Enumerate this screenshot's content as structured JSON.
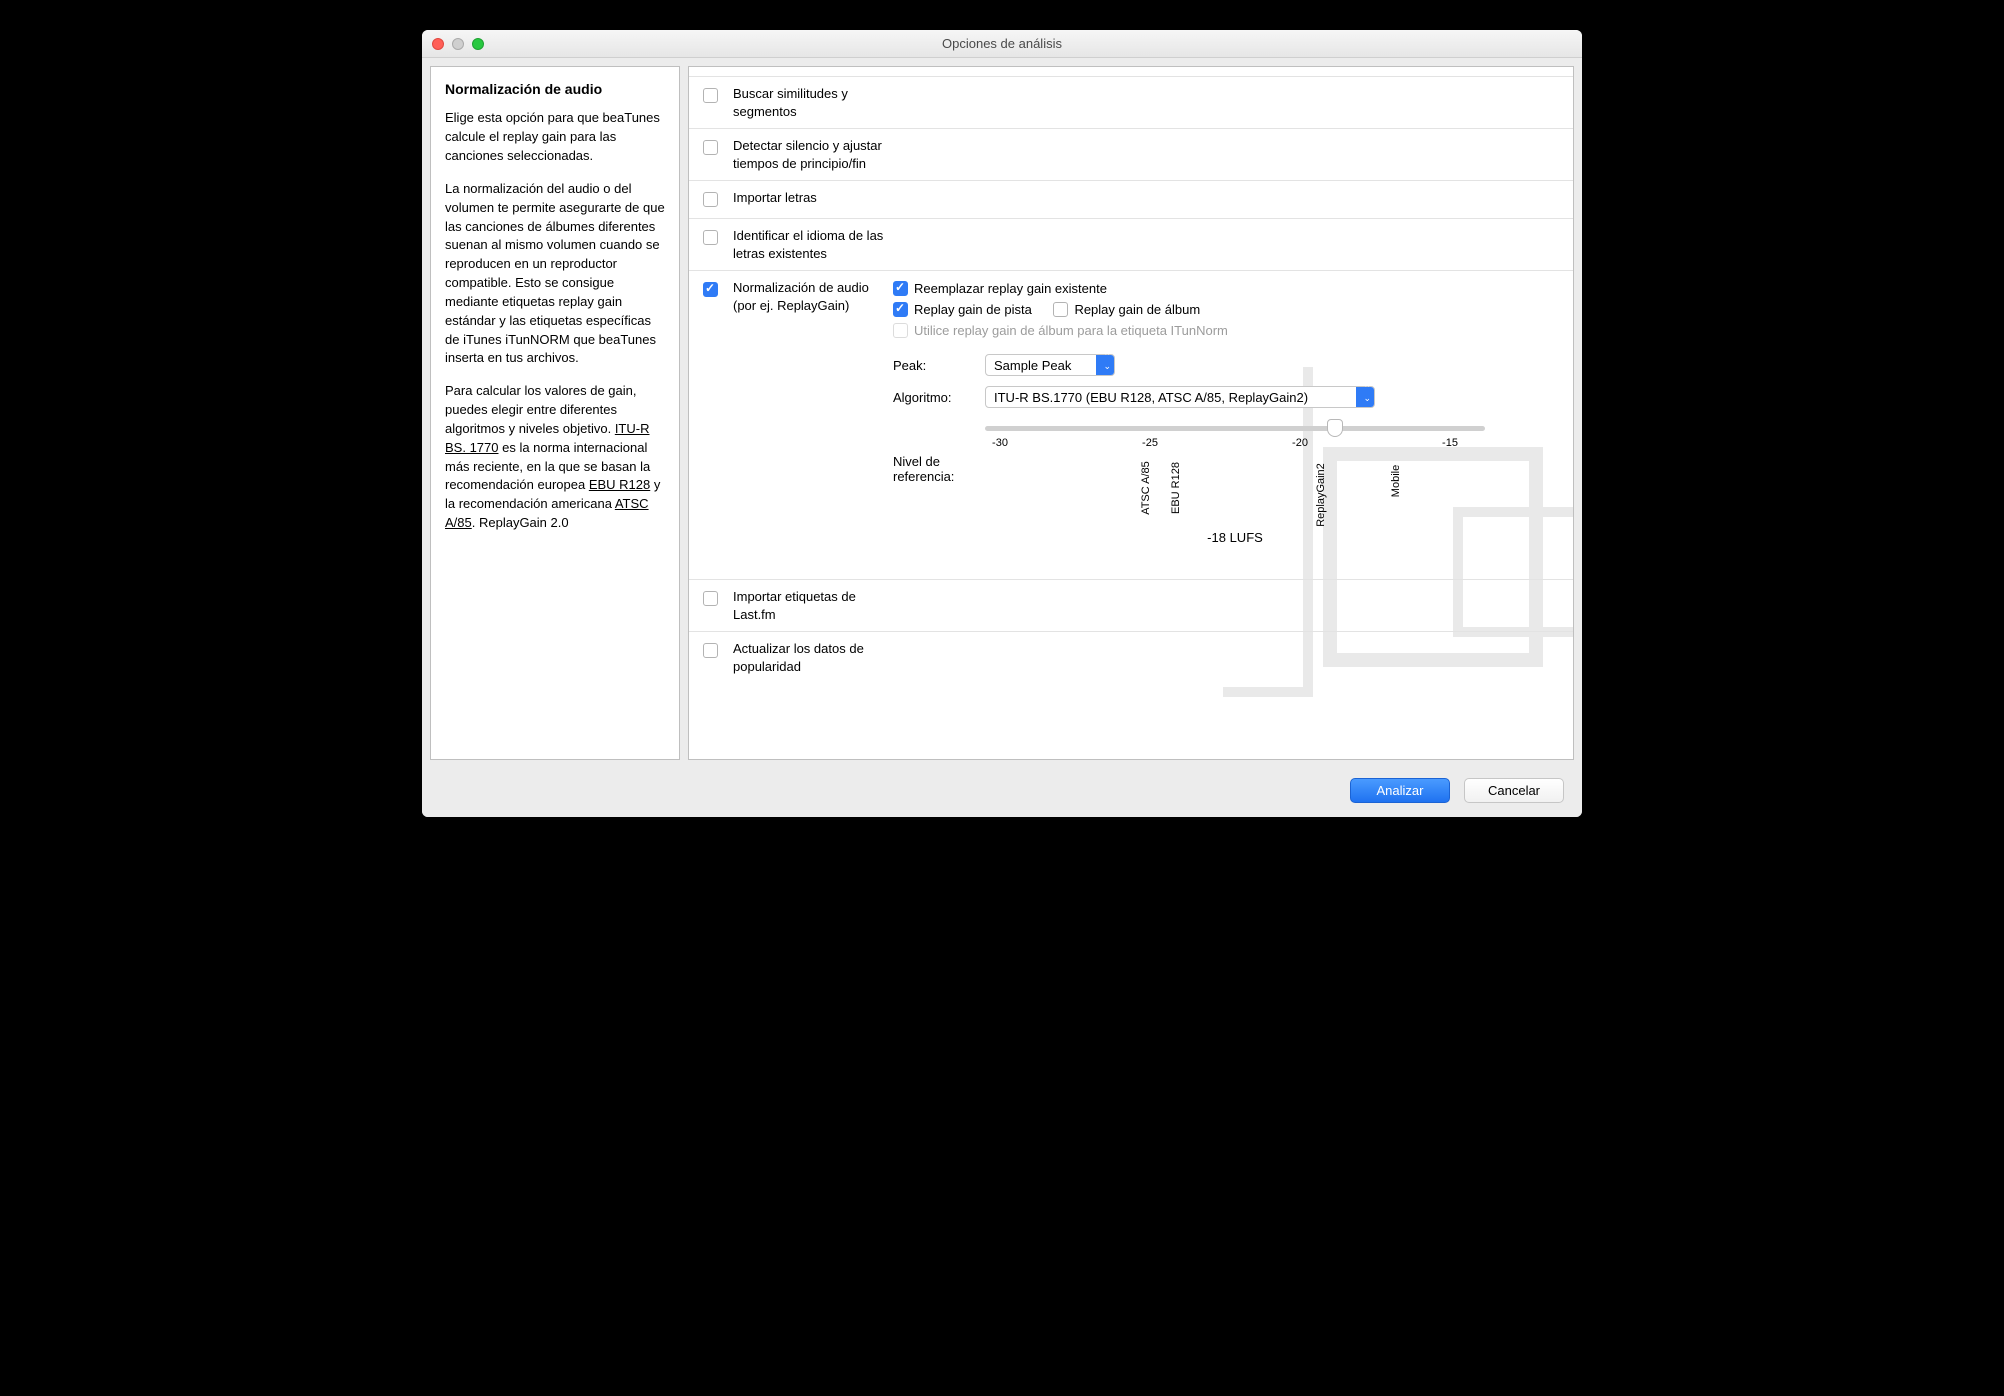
{
  "titlebar": {
    "title": "Opciones de análisis"
  },
  "sidebar": {
    "heading": "Normalización de audio",
    "p1": "Elige esta opción para que beaTunes calcule el replay gain para las canciones seleccionadas.",
    "p2": "La normalización del audio o del volumen te permite asegurarte de que las canciones de álbumes diferentes suenan al mismo volumen cuando se reproducen en un reproductor compatible. Esto se consigue mediante etiquetas replay gain estándar y las etiquetas específicas de iTunes iTunNORM que beaTunes inserta en tus archivos.",
    "p3a": "Para calcular los valores de gain, puedes elegir entre diferentes algoritmos y niveles objetivo. ",
    "link1": "ITU-R BS. 1770",
    "p3b": " es la norma internacional más reciente, en la que se basan la recomendación europea ",
    "link2": "EBU R128",
    "p3c": " y la recomendación americana ",
    "link3": "ATSC A/85",
    "p3d": ". ReplayGain 2.0"
  },
  "rows": {
    "similitudes": "Buscar similitudes y segmentos",
    "silencio": "Detectar silencio y ajustar tiempos de principio/fin",
    "letras": "Importar letras",
    "idioma": "Identificar el idioma de las letras existentes",
    "norm_title": "Normalización de audio (por ej. ReplayGain)",
    "reemplazar": "Reemplazar replay gain existente",
    "pista": "Replay gain de pista",
    "album": "Replay gain de álbum",
    "itunnorm": "Utilice replay gain de álbum para la etiqueta ITunNorm",
    "peak_label": "Peak:",
    "peak_value": "Sample Peak",
    "algo_label": "Algoritmo:",
    "algo_value": "ITU-R BS.1770 (EBU R128, ATSC A/85, ReplayGain2)",
    "nivel_label1": "Nivel de",
    "nivel_label2": "referencia:",
    "lufs": "-18 LUFS",
    "ticks_num": {
      "n30": "-30",
      "n25": "-25",
      "n20": "-20",
      "n15": "-15"
    },
    "ticks_lbl": {
      "atsc": "ATSC A/85",
      "ebu": "EBU R128",
      "rg2": "ReplayGain2",
      "mobile": "Mobile"
    },
    "lastfm": "Importar etiquetas de Last.fm",
    "popularidad": "Actualizar los datos de popularidad"
  },
  "footer": {
    "analizar": "Analizar",
    "cancelar": "Cancelar"
  }
}
